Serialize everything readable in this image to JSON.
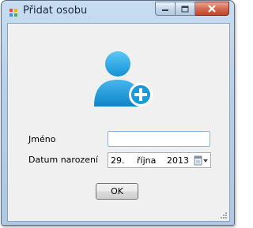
{
  "window": {
    "title": "Přidat osobu",
    "controls": [
      "minimize-icon",
      "maximize-icon",
      "close-icon"
    ]
  },
  "form": {
    "name_label": "Jméno",
    "name_value": "",
    "birthdate_label": "Datum narození",
    "birthdate": {
      "day": "29.",
      "month": "října",
      "year": "2013"
    },
    "ok_label": "OK"
  },
  "icons": {
    "header": "add-user-icon",
    "accent": "#1a9ad9"
  }
}
